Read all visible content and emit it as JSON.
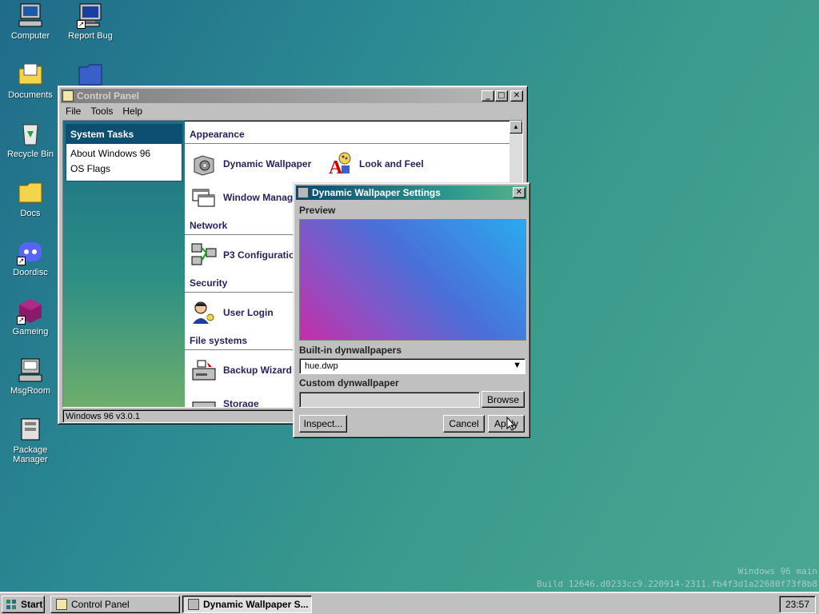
{
  "desktop": {
    "icons": [
      {
        "label": "Computer"
      },
      {
        "label": "Report Bug"
      },
      {
        "label": "Documents"
      },
      {
        "label": "Recycle Bin"
      },
      {
        "label": "Docs"
      },
      {
        "label": "Doordisc"
      },
      {
        "label": "Gameing"
      },
      {
        "label": "MsgRoom"
      },
      {
        "label": "Package Manager"
      }
    ]
  },
  "control_panel": {
    "title": "Control Panel",
    "menu": [
      "File",
      "Tools",
      "Help"
    ],
    "system_tasks": {
      "heading": "System Tasks",
      "items": [
        "About Windows 96",
        "OS Flags"
      ]
    },
    "sections": {
      "appearance": "Appearance",
      "network": "Network",
      "security": "Security",
      "file_systems": "File systems"
    },
    "items": {
      "dynamic_wallpaper": "Dynamic Wallpaper",
      "look_and_feel": "Look and Feel",
      "window_manager": "Window Manag",
      "p3_configuration": "P3 Configuratio",
      "user_login": "User Login",
      "backup_wizard": "Backup Wizard",
      "storage": "Storage"
    },
    "status": "Windows 96 v3.0.1"
  },
  "dynwall_dialog": {
    "title": "Dynamic Wallpaper Settings",
    "preview_label": "Preview",
    "builtin_label": "Built-in dynwallpapers",
    "builtin_value": "hue.dwp",
    "custom_label": "Custom dynwallpaper",
    "custom_value": "",
    "browse": "Browse",
    "inspect": "Inspect...",
    "cancel": "Cancel",
    "apply": "Apply"
  },
  "watermark": {
    "line1": "Windows 96 main",
    "line2": "Build 12646.d0233cc9.220914-2311.fb4f3d1a22680f73f8b8"
  },
  "taskbar": {
    "start": "Start",
    "tasks": [
      "Control Panel",
      "Dynamic Wallpaper S..."
    ],
    "clock": "23:57"
  },
  "colors": {
    "active_title": "#0a4a6e",
    "section_text": "#2a1e5c"
  }
}
